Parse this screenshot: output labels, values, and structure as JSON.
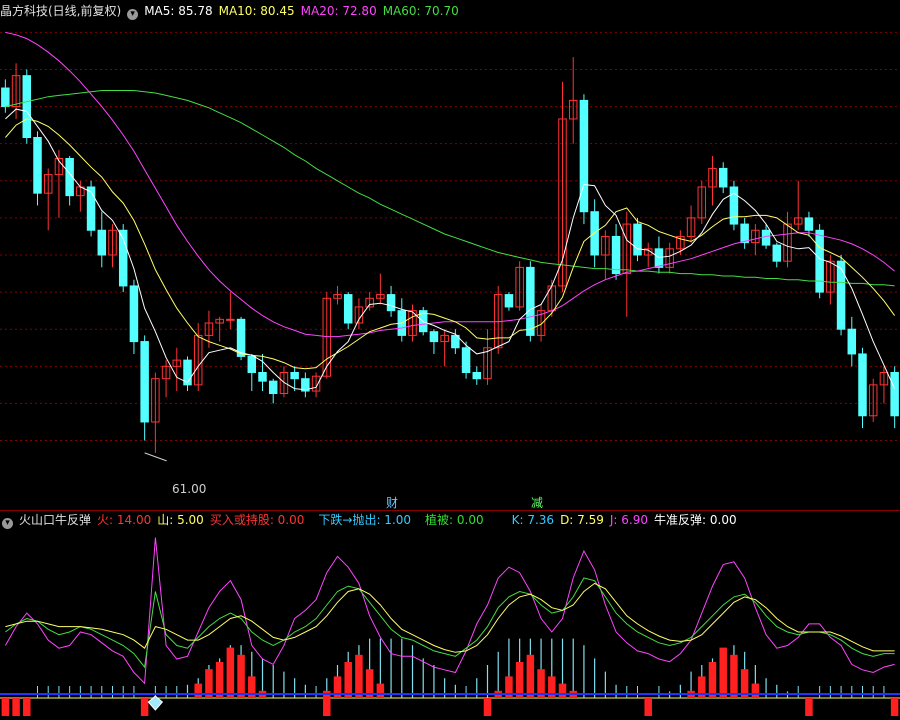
{
  "main": {
    "title": "晶方科技(日线,前复权)",
    "ma": [
      {
        "label": "MA5: 85.78",
        "color": "#ffffff"
      },
      {
        "label": "MA10: 80.45",
        "color": "#ffff66"
      },
      {
        "label": "MA20: 72.80",
        "color": "#ff44ff"
      },
      {
        "label": "MA60: 70.70",
        "color": "#44dd44"
      }
    ],
    "low_label": "61.00",
    "markers": [
      {
        "text": "财",
        "color": "#66ccff"
      },
      {
        "text": "减",
        "color": "#66ff66"
      }
    ]
  },
  "sub": {
    "title": "火山口牛反弹",
    "items": [
      {
        "label": "火: 14.00",
        "color": "#ff3333"
      },
      {
        "label": "山: 5.00",
        "color": "#ffff66"
      },
      {
        "label": "买入或持股: 0.00",
        "color": "#ff3333"
      },
      {
        "label": "下跌→抛出: 1.00",
        "color": "#33ccff"
      },
      {
        "label": "植被: 0.00",
        "color": "#33dd33"
      },
      {
        "label": "K: 7.36",
        "color": "#33ccff"
      },
      {
        "label": "D: 7.59",
        "color": "#ffff66"
      },
      {
        "label": "J: 6.90",
        "color": "#ff44ff"
      },
      {
        "label": "牛准反弹: 0.00",
        "color": "#ffffff"
      }
    ]
  },
  "colors": {
    "up": "#ff3333",
    "down": "#54ffff",
    "grid": "#880000",
    "ma5": "#ffffff",
    "ma10": "#ffff66",
    "ma20": "#ff44ff",
    "ma60": "#44dd44"
  },
  "chart_data": {
    "type": "candlestick",
    "candles": [
      [
        90.5,
        91.2,
        88.5,
        89.0
      ],
      [
        89.0,
        92.5,
        88.0,
        91.5
      ],
      [
        91.5,
        92.0,
        86.0,
        86.5
      ],
      [
        86.5,
        87.0,
        81.0,
        82.0
      ],
      [
        82.0,
        84.0,
        79.0,
        83.5
      ],
      [
        83.5,
        85.5,
        80.0,
        84.8
      ],
      [
        84.8,
        85.0,
        81.0,
        81.8
      ],
      [
        81.8,
        83.0,
        80.5,
        82.5
      ],
      [
        82.5,
        83.0,
        78.5,
        79.0
      ],
      [
        79.0,
        80.5,
        76.0,
        77.0
      ],
      [
        77.0,
        79.5,
        76.0,
        79.0
      ],
      [
        79.0,
        79.5,
        74.0,
        74.5
      ],
      [
        74.5,
        75.0,
        69.0,
        70.0
      ],
      [
        70.0,
        70.5,
        62.0,
        63.5
      ],
      [
        63.5,
        67.5,
        61.0,
        67.0
      ],
      [
        67.0,
        68.5,
        65.5,
        68.0
      ],
      [
        68.0,
        69.5,
        66.0,
        68.5
      ],
      [
        68.5,
        68.8,
        66.0,
        66.5
      ],
      [
        66.5,
        71.5,
        66.0,
        70.5
      ],
      [
        70.5,
        72.5,
        69.5,
        71.5
      ],
      [
        71.5,
        72.0,
        70.0,
        71.8
      ],
      [
        71.8,
        74.0,
        71.0,
        71.8
      ],
      [
        71.8,
        72.0,
        68.5,
        68.8
      ],
      [
        68.8,
        69.0,
        66.0,
        67.5
      ],
      [
        67.5,
        69.0,
        66.0,
        66.8
      ],
      [
        66.8,
        67.0,
        65.0,
        65.8
      ],
      [
        65.8,
        68.0,
        65.5,
        67.5
      ],
      [
        67.5,
        68.0,
        66.0,
        67.0
      ],
      [
        67.0,
        67.5,
        65.5,
        66.0
      ],
      [
        66.0,
        67.5,
        65.5,
        67.2
      ],
      [
        67.2,
        74.0,
        67.0,
        73.5
      ],
      [
        73.5,
        74.5,
        73.0,
        73.8
      ],
      [
        73.8,
        74.0,
        71.0,
        71.5
      ],
      [
        71.5,
        73.5,
        71.0,
        72.8
      ],
      [
        72.8,
        74.0,
        72.5,
        73.5
      ],
      [
        73.5,
        75.5,
        73.0,
        73.8
      ],
      [
        73.8,
        74.5,
        72.0,
        72.5
      ],
      [
        72.5,
        73.5,
        70.0,
        70.5
      ],
      [
        70.5,
        73.0,
        70.0,
        72.5
      ],
      [
        72.5,
        72.8,
        70.5,
        70.8
      ],
      [
        70.8,
        71.0,
        69.0,
        70.0
      ],
      [
        70.0,
        71.0,
        68.0,
        70.5
      ],
      [
        70.5,
        71.0,
        69.0,
        69.5
      ],
      [
        69.5,
        70.0,
        67.0,
        67.5
      ],
      [
        67.5,
        68.0,
        66.5,
        67.0
      ],
      [
        67.0,
        71.0,
        66.5,
        69.5
      ],
      [
        69.5,
        74.5,
        69.0,
        73.8
      ],
      [
        73.8,
        74.0,
        72.5,
        72.8
      ],
      [
        72.8,
        76.5,
        72.5,
        76.0
      ],
      [
        76.0,
        76.5,
        70.0,
        70.5
      ],
      [
        70.5,
        73.0,
        70.0,
        72.5
      ],
      [
        72.5,
        75.0,
        72.0,
        74.5
      ],
      [
        74.5,
        91.0,
        74.0,
        88.0
      ],
      [
        88.0,
        93.0,
        86.0,
        89.5
      ],
      [
        89.5,
        90.0,
        79.5,
        80.5
      ],
      [
        80.5,
        81.5,
        76.0,
        77.0
      ],
      [
        77.0,
        79.0,
        75.0,
        78.5
      ],
      [
        78.5,
        79.5,
        75.0,
        75.5
      ],
      [
        75.5,
        80.5,
        72.0,
        79.5
      ],
      [
        79.5,
        80.0,
        76.5,
        77.0
      ],
      [
        77.0,
        78.0,
        76.0,
        77.5
      ],
      [
        77.5,
        78.5,
        75.5,
        76.0
      ],
      [
        76.0,
        78.0,
        75.5,
        77.5
      ],
      [
        77.5,
        79.0,
        77.0,
        78.5
      ],
      [
        78.5,
        81.0,
        78.0,
        80.0
      ],
      [
        80.0,
        83.0,
        79.5,
        82.5
      ],
      [
        82.5,
        85.0,
        81.0,
        84.0
      ],
      [
        84.0,
        84.5,
        82.0,
        82.5
      ],
      [
        82.5,
        83.0,
        79.0,
        79.5
      ],
      [
        79.5,
        80.0,
        77.5,
        78.0
      ],
      [
        78.0,
        79.5,
        77.0,
        79.0
      ],
      [
        79.0,
        79.5,
        77.5,
        77.8
      ],
      [
        77.8,
        78.0,
        76.0,
        76.5
      ],
      [
        76.5,
        80.5,
        76.0,
        79.5
      ],
      [
        79.5,
        83.0,
        79.0,
        80.0
      ],
      [
        80.0,
        80.5,
        78.5,
        79.0
      ],
      [
        79.0,
        79.5,
        73.5,
        74.0
      ],
      [
        74.0,
        77.0,
        73.0,
        76.5
      ],
      [
        76.5,
        77.0,
        70.5,
        71.0
      ],
      [
        71.0,
        72.0,
        68.0,
        69.0
      ],
      [
        69.0,
        69.5,
        63.0,
        64.0
      ],
      [
        64.0,
        67.0,
        63.5,
        66.5
      ],
      [
        66.5,
        68.0,
        65.0,
        67.5
      ],
      [
        67.5,
        68.0,
        63.0,
        64.0
      ]
    ],
    "ma5": [
      88.0,
      88.8,
      88.6,
      87.4,
      86.2,
      84.6,
      83.6,
      82.5,
      82.1,
      80.6,
      79.8,
      78.3,
      75.9,
      72.7,
      70.8,
      68.7,
      67.1,
      66.7,
      68.0,
      69.1,
      69.3,
      69.5,
      69.1,
      68.9,
      68.4,
      67.5,
      66.7,
      66.2,
      66.1,
      66.3,
      68.0,
      69.2,
      70.0,
      71.8,
      73.0,
      73.1,
      72.9,
      72.6,
      72.4,
      71.6,
      71.3,
      70.9,
      70.6,
      69.7,
      69.0,
      69.2,
      69.6,
      70.0,
      71.8,
      72.6,
      73.0,
      74.5,
      76.6,
      80.0,
      82.7,
      82.6,
      81.0,
      80.2,
      78.2,
      77.5,
      77.4,
      76.8,
      76.9,
      77.3,
      77.8,
      78.8,
      80.3,
      81.5,
      82.0,
      81.4,
      80.6,
      79.5,
      78.1,
      77.7,
      77.5,
      77.6,
      76.7,
      76.4,
      75.9,
      74.3,
      72.2,
      70.0,
      68.1,
      66.2
    ],
    "ma10": [
      86.5,
      87.5,
      88.0,
      87.8,
      87.4,
      86.7,
      85.9,
      85.0,
      84.1,
      83.3,
      82.1,
      81.2,
      79.8,
      77.9,
      75.8,
      74.2,
      72.7,
      71.5,
      70.4,
      70.0,
      69.7,
      69.4,
      69.0,
      68.9,
      68.8,
      68.6,
      68.3,
      67.9,
      67.8,
      67.9,
      68.6,
      69.1,
      69.6,
      70.2,
      70.8,
      71.1,
      71.4,
      71.5,
      72.0,
      72.3,
      72.2,
      71.9,
      71.6,
      71.1,
      70.3,
      70.2,
      70.3,
      70.3,
      70.9,
      71.0,
      71.4,
      72.3,
      73.6,
      76.0,
      78.1,
      78.8,
      79.4,
      80.5,
      80.8,
      79.7,
      79.4,
      78.9,
      78.6,
      78.3,
      78.1,
      78.6,
      79.3,
      79.9,
      80.1,
      80.1,
      80.2,
      80.2,
      80.0,
      79.4,
      78.8,
      78.6,
      77.6,
      77.2,
      76.8,
      76.0,
      75.2,
      74.3,
      73.3,
      72.1
    ],
    "ma20": [
      95.0,
      94.8,
      94.5,
      94.0,
      93.4,
      92.7,
      91.9,
      91.0,
      90.0,
      89.0,
      87.9,
      86.7,
      85.4,
      83.9,
      82.4,
      80.9,
      79.4,
      78.1,
      76.9,
      75.8,
      74.9,
      74.1,
      73.4,
      72.7,
      72.1,
      71.6,
      71.2,
      70.9,
      70.6,
      70.5,
      70.4,
      70.4,
      70.5,
      70.6,
      70.7,
      70.9,
      71.0,
      71.1,
      71.3,
      71.4,
      71.5,
      71.6,
      71.6,
      71.6,
      71.6,
      71.6,
      71.6,
      71.7,
      71.8,
      72.0,
      72.2,
      72.5,
      72.9,
      73.5,
      74.1,
      74.6,
      75.0,
      75.3,
      75.6,
      75.7,
      75.9,
      76.1,
      76.3,
      76.5,
      76.7,
      77.0,
      77.3,
      77.6,
      77.9,
      78.1,
      78.3,
      78.5,
      78.6,
      78.7,
      78.8,
      78.8,
      78.6,
      78.4,
      78.2,
      77.9,
      77.5,
      77.0,
      76.4,
      75.7
    ],
    "ma60": [
      89.0,
      89.2,
      89.4,
      89.6,
      89.8,
      89.9,
      90.0,
      90.1,
      90.2,
      90.3,
      90.3,
      90.3,
      90.3,
      90.2,
      90.1,
      89.9,
      89.7,
      89.5,
      89.2,
      88.9,
      88.5,
      88.1,
      87.7,
      87.2,
      86.7,
      86.2,
      85.7,
      85.1,
      84.6,
      84.0,
      83.5,
      83.0,
      82.5,
      82.0,
      81.6,
      81.1,
      80.7,
      80.3,
      79.9,
      79.5,
      79.1,
      78.7,
      78.4,
      78.1,
      77.8,
      77.5,
      77.2,
      77.0,
      76.8,
      76.6,
      76.4,
      76.3,
      76.2,
      76.1,
      76.0,
      75.9,
      75.9,
      75.8,
      75.8,
      75.7,
      75.7,
      75.6,
      75.6,
      75.5,
      75.5,
      75.4,
      75.4,
      75.3,
      75.3,
      75.2,
      75.2,
      75.1,
      75.1,
      75.0,
      75.0,
      74.9,
      74.9,
      74.8,
      74.8,
      74.7,
      74.7,
      74.6,
      74.6,
      74.5
    ],
    "osc": {
      "k": [
        40,
        46,
        50,
        48,
        42,
        38,
        40,
        44,
        42,
        38,
        34,
        30,
        24,
        14,
        70,
        38,
        30,
        28,
        36,
        44,
        50,
        54,
        50,
        40,
        34,
        30,
        34,
        40,
        44,
        50,
        60,
        70,
        74,
        72,
        62,
        52,
        42,
        36,
        34,
        30,
        26,
        24,
        22,
        28,
        34,
        44,
        58,
        66,
        70,
        68,
        60,
        54,
        56,
        66,
        80,
        78,
        66,
        54,
        46,
        40,
        36,
        32,
        30,
        32,
        36,
        44,
        52,
        60,
        66,
        68,
        62,
        52,
        44,
        40,
        38,
        40,
        40,
        38,
        34,
        28,
        24,
        22,
        24,
        24
      ],
      "d": [
        44,
        46,
        48,
        48,
        46,
        44,
        44,
        44,
        43,
        42,
        40,
        38,
        34,
        28,
        44,
        42,
        38,
        34,
        34,
        38,
        44,
        50,
        52,
        48,
        42,
        36,
        34,
        36,
        40,
        44,
        52,
        62,
        70,
        72,
        68,
        60,
        50,
        42,
        38,
        34,
        30,
        27,
        25,
        26,
        30,
        38,
        50,
        60,
        66,
        68,
        64,
        58,
        56,
        60,
        70,
        76,
        72,
        62,
        52,
        46,
        41,
        37,
        34,
        33,
        34,
        38,
        46,
        54,
        62,
        66,
        64,
        58,
        50,
        44,
        40,
        40,
        40,
        40,
        37,
        33,
        29,
        26,
        26,
        26
      ],
      "j": [
        30,
        44,
        54,
        46,
        34,
        28,
        30,
        40,
        38,
        32,
        26,
        22,
        10,
        2,
        110,
        30,
        20,
        22,
        40,
        58,
        70,
        78,
        64,
        30,
        20,
        16,
        30,
        50,
        56,
        64,
        84,
        96,
        88,
        76,
        52,
        36,
        24,
        22,
        22,
        18,
        14,
        12,
        10,
        26,
        46,
        60,
        80,
        88,
        84,
        70,
        50,
        40,
        50,
        80,
        100,
        86,
        60,
        40,
        32,
        26,
        24,
        20,
        18,
        24,
        34,
        54,
        74,
        90,
        92,
        80,
        58,
        38,
        28,
        30,
        36,
        46,
        46,
        36,
        30,
        16,
        12,
        10,
        14,
        16
      ],
      "bars": [
        0,
        0,
        0,
        0,
        0,
        0,
        0,
        0,
        0,
        0,
        0,
        0,
        0,
        0,
        0,
        0,
        0,
        0,
        4,
        8,
        10,
        14,
        12,
        6,
        2,
        0,
        0,
        0,
        0,
        0,
        2,
        6,
        10,
        12,
        8,
        4,
        0,
        0,
        0,
        0,
        0,
        0,
        0,
        0,
        0,
        0,
        2,
        6,
        10,
        12,
        8,
        6,
        4,
        2,
        0,
        0,
        0,
        0,
        0,
        0,
        0,
        0,
        0,
        0,
        2,
        6,
        10,
        14,
        12,
        8,
        4,
        0,
        0,
        0,
        0,
        0,
        0,
        0,
        0,
        0,
        0,
        0,
        0,
        0
      ],
      "mountain": [
        0,
        0,
        0,
        0,
        0,
        0,
        0,
        0,
        0,
        0,
        0,
        0,
        0,
        0,
        0,
        0,
        0,
        4,
        6,
        10,
        12,
        16,
        16,
        14,
        12,
        10,
        8,
        6,
        4,
        0,
        6,
        10,
        14,
        16,
        18,
        18,
        18,
        18,
        16,
        12,
        10,
        6,
        4,
        0,
        6,
        10,
        14,
        18,
        18,
        18,
        18,
        18,
        18,
        18,
        16,
        12,
        8,
        4,
        0,
        0,
        0,
        0,
        2,
        4,
        8,
        10,
        12,
        14,
        16,
        14,
        10,
        6,
        4,
        2,
        0,
        0,
        0,
        0,
        0,
        0,
        0,
        0,
        0,
        0
      ],
      "neg": [
        1,
        1,
        1,
        0,
        0,
        0,
        0,
        0,
        0,
        0,
        0,
        0,
        0,
        1,
        0,
        0,
        0,
        0,
        0,
        0,
        0,
        0,
        0,
        0,
        0,
        0,
        0,
        0,
        0,
        0,
        1,
        0,
        0,
        0,
        0,
        0,
        0,
        0,
        0,
        0,
        0,
        0,
        0,
        0,
        0,
        1,
        0,
        0,
        0,
        0,
        0,
        0,
        0,
        0,
        0,
        0,
        0,
        0,
        0,
        0,
        1,
        0,
        0,
        0,
        0,
        0,
        0,
        0,
        0,
        0,
        0,
        0,
        0,
        0,
        0,
        1,
        0,
        0,
        0,
        0,
        0,
        0,
        0,
        1
      ]
    }
  }
}
